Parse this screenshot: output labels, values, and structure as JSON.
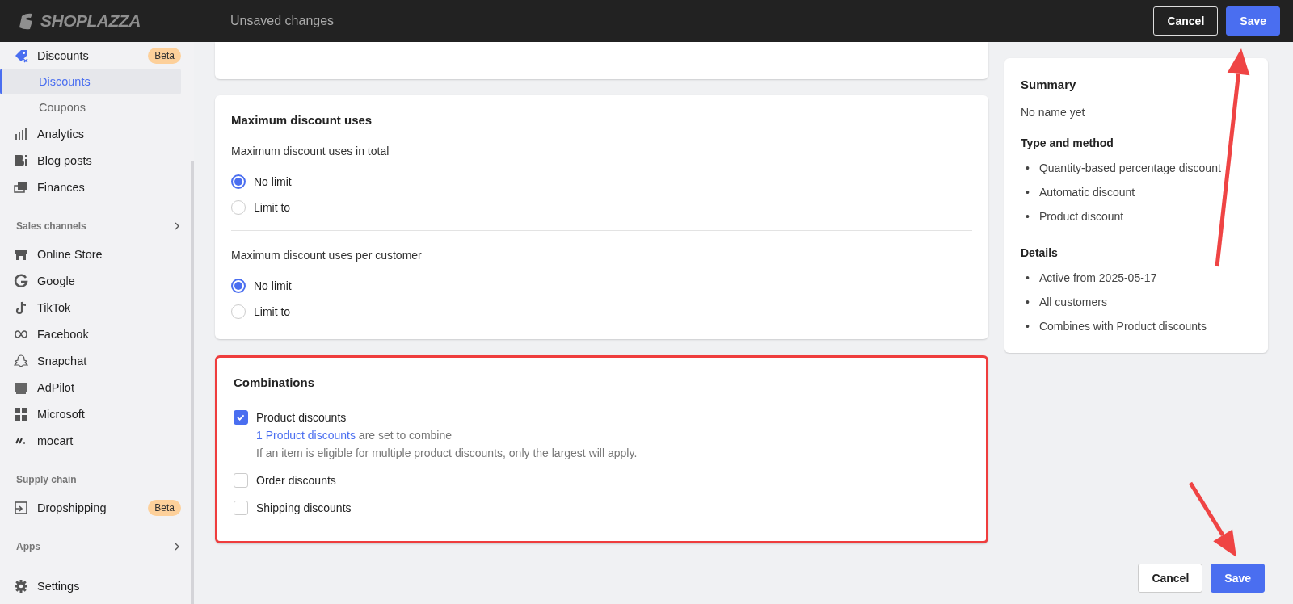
{
  "header": {
    "logo": "SHOPLAZZA",
    "status": "Unsaved changes",
    "buttons": [
      {
        "label": "Cancel",
        "kind": "secondary"
      },
      {
        "label": "Save",
        "kind": "primary"
      }
    ]
  },
  "sidebar": {
    "items": [
      {
        "kind": "item",
        "label": "Discounts",
        "badge": "Beta",
        "selected": false
      },
      {
        "kind": "sub",
        "label": "Discounts",
        "selected": true
      },
      {
        "kind": "sub",
        "label": "Coupons",
        "selected": false
      },
      {
        "kind": "item",
        "label": "Analytics",
        "selected": false
      },
      {
        "kind": "item",
        "label": "Blog posts",
        "selected": false
      },
      {
        "kind": "item",
        "label": "Finances",
        "selected": false
      },
      {
        "kind": "heading",
        "label": "Sales channels"
      },
      {
        "kind": "item",
        "label": "Online Store",
        "selected": false
      },
      {
        "kind": "item",
        "label": "Google",
        "selected": false
      },
      {
        "kind": "item",
        "label": "TikTok",
        "selected": false
      },
      {
        "kind": "item",
        "label": "Facebook",
        "selected": false
      },
      {
        "kind": "item",
        "label": "Snapchat",
        "selected": false
      },
      {
        "kind": "item",
        "label": "AdPilot",
        "selected": false
      },
      {
        "kind": "item",
        "label": "Microsoft",
        "selected": false
      },
      {
        "kind": "item",
        "label": "mocart",
        "selected": false
      },
      {
        "kind": "heading",
        "label": "Supply chain"
      },
      {
        "kind": "item",
        "label": "Dropshipping",
        "badge": "Beta",
        "selected": false
      },
      {
        "kind": "heading",
        "label": "Apps"
      },
      {
        "kind": "item",
        "label": "Settings",
        "selected": false
      }
    ]
  },
  "max_uses": {
    "title": "Maximum discount uses",
    "groups": [
      {
        "label": "Maximum discount uses in total",
        "options": [
          {
            "label": "No limit",
            "selected": true
          },
          {
            "label": "Limit to",
            "selected": false
          }
        ]
      },
      {
        "label": "Maximum discount uses per customer",
        "options": [
          {
            "label": "No limit",
            "selected": true
          },
          {
            "label": "Limit to",
            "selected": false
          }
        ]
      }
    ]
  },
  "combinations": {
    "title": "Combinations",
    "highlighted": true,
    "options": [
      {
        "label": "Product discounts",
        "checked": true,
        "note_link": "1 Product discounts",
        "note_text": "are set to combine",
        "help": "If an item is eligible for multiple product discounts, only the largest will apply."
      },
      {
        "label": "Order discounts",
        "checked": false
      },
      {
        "label": "Shipping discounts",
        "checked": false
      }
    ]
  },
  "summary": {
    "title": "Summary",
    "bullet": "•",
    "name": "No name yet",
    "sections": [
      {
        "heading": "Type and method",
        "items": [
          "Quantity-based percentage discount",
          "Automatic discount",
          "Product discount"
        ]
      },
      {
        "heading": "Details",
        "items": [
          "Active from 2025-05-17",
          "All customers",
          "Combines with Product discounts"
        ]
      }
    ]
  },
  "footer": {
    "buttons": [
      {
        "label": "Cancel",
        "kind": "secondary"
      },
      {
        "label": "Save",
        "kind": "primary"
      }
    ]
  },
  "annotations": [
    {
      "kind": "arrow"
    },
    {
      "kind": "arrow"
    }
  ]
}
